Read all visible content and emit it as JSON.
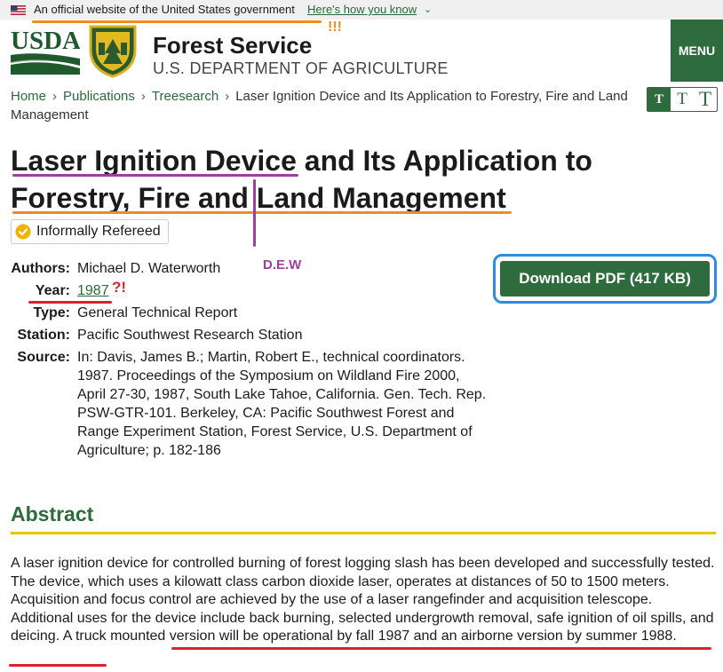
{
  "gov_banner": {
    "text": "An official website of the United States government",
    "link": "Here's how you know",
    "chevron": "⌄"
  },
  "header": {
    "usda_text": "USDA",
    "title": "Forest Service",
    "subtitle": "U.S. DEPARTMENT OF AGRICULTURE",
    "menu_label": "MENU"
  },
  "breadcrumb": {
    "items": [
      "Home",
      "Publications",
      "Treesearch"
    ],
    "current": "Laser Ignition Device and Its Application to Forestry, Fire and Land Management",
    "separator": "›"
  },
  "text_size": {
    "labels": [
      "T",
      "T",
      "T"
    ]
  },
  "title": "Laser Ignition Device and Its Application to Forestry, Fire and Land Management",
  "badge": {
    "label": "Informally Refereed"
  },
  "meta": {
    "authors_label": "Authors:",
    "authors": "Michael D. Waterworth",
    "year_label": "Year:",
    "year": "1987",
    "type_label": "Type:",
    "type": "General Technical Report",
    "station_label": "Station:",
    "station": "Pacific Southwest Research Station",
    "source_label": "Source:",
    "source": "In: Davis, James B.; Martin, Robert E., technical coordinators. 1987. Proceedings of the Symposium on Wildland Fire 2000, April 27-30, 1987, South Lake Tahoe, California. Gen. Tech. Rep. PSW-GTR-101. Berkeley, CA: Pacific Southwest Forest and Range Experiment Station, Forest Service, U.S. Department of Agriculture; p. 182-186"
  },
  "download": {
    "label": "Download PDF (417 KB)"
  },
  "abstract": {
    "heading": "Abstract",
    "body": "A laser ignition device for controlled burning of forest logging slash has been developed and successfully tested. The device, which uses a kilowatt class carbon dioxide laser, operates at distances of 50 to 1500 meters. Acquisition and focus control are achieved by the use of a laser rangefinder and acquisition telescope. Additional uses for the device include back burning, selected undergrowth removal, safe ignition of oil spills, and deicing. A truck mounted version will be operational by fall 1987 and an airborne version by summer 1988."
  },
  "annotations": {
    "exclaim_orange": "!!!",
    "dew": "D.E.W",
    "year_mark": "?!"
  },
  "colors": {
    "brand_green": "#2e6b3d",
    "link_green": "#2a6a3a",
    "annotation_orange": "#f08a24",
    "annotation_red": "#d9232a",
    "annotation_purple": "#9c3fa0",
    "highlight_blue": "#2f8be0",
    "rule_yellow": "#ecc500"
  }
}
